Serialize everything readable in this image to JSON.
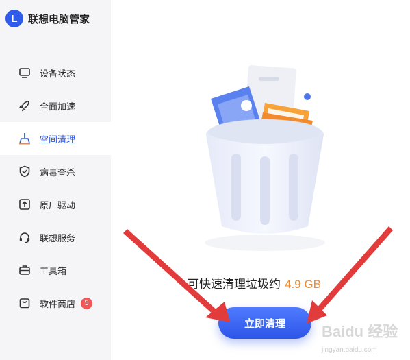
{
  "app": {
    "logo_letter": "L",
    "title": "联想电脑管家"
  },
  "sidebar": {
    "items": [
      {
        "label": "设备状态",
        "icon": "monitor-icon"
      },
      {
        "label": "全面加速",
        "icon": "rocket-icon"
      },
      {
        "label": "空间清理",
        "icon": "broom-icon",
        "active": true
      },
      {
        "label": "病毒查杀",
        "icon": "shield-check-icon"
      },
      {
        "label": "原厂驱动",
        "icon": "upload-box-icon"
      },
      {
        "label": "联想服务",
        "icon": "headset-icon"
      },
      {
        "label": "工具箱",
        "icon": "toolbox-icon"
      },
      {
        "label": "软件商店",
        "icon": "shopping-bag-icon",
        "badge": "5"
      }
    ]
  },
  "main": {
    "result_prefix": "可快速清理垃圾约",
    "result_size": "4.9 GB",
    "clean_button": "立即清理"
  },
  "watermark": {
    "text": "Baidu 经验",
    "url": "jingyan.baidu.com"
  },
  "colors": {
    "accent": "#2f5bea",
    "size_highlight": "#f28a2e",
    "arrow": "#e23b3b",
    "badge": "#f25656"
  }
}
